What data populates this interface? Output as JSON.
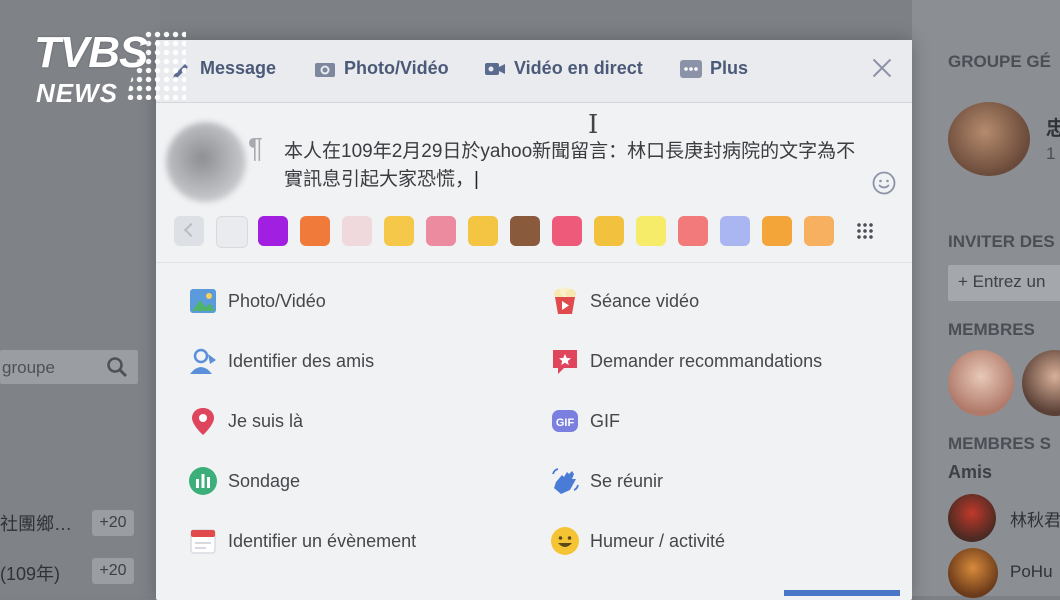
{
  "logo": {
    "brand": "TVBS",
    "sub": "NEWS"
  },
  "composer": {
    "tabs": [
      {
        "label": "Message",
        "icon": "pencil-icon"
      },
      {
        "label": "Photo/Vidéo",
        "icon": "camera-icon"
      },
      {
        "label": "Vidéo en direct",
        "icon": "video-camera-icon"
      },
      {
        "label": "Plus",
        "icon": "more-dots-icon"
      }
    ],
    "status_text": "本人在109年2月29日於yahoo新聞留言：林口長庚封病院的文字為不實訊息引起大家恐慌，",
    "emoji_swatches": [
      "#a11fe0",
      "#f07a3a",
      "#efd9dc",
      "#f5c84a",
      "#ec8aa0",
      "#f4c542",
      "#8a5a3c",
      "#ee5a7a",
      "#f2c23e",
      "#f6ec6a",
      "#f27a7a",
      "#aab6f2",
      "#f3a53a",
      "#f7b060"
    ],
    "options_left": [
      {
        "label": "Photo/Vidéo",
        "icon": "photo-icon",
        "color": "#4fb36e"
      },
      {
        "label": "Identifier des amis",
        "icon": "tag-friends-icon",
        "color": "#5b8fd9"
      },
      {
        "label": "Je suis là",
        "icon": "location-pin-icon",
        "color": "#e0455e"
      },
      {
        "label": "Sondage",
        "icon": "poll-icon",
        "color": "#3cae7a"
      },
      {
        "label": "Identifier un évènement",
        "icon": "calendar-icon",
        "color": "#e04a4a"
      }
    ],
    "options_right": [
      {
        "label": "Séance vidéo",
        "icon": "popcorn-icon",
        "color": "#e04a4a"
      },
      {
        "label": "Demander recommandations",
        "icon": "recommend-icon",
        "color": "#e0455e"
      },
      {
        "label": "GIF",
        "icon": "gif-icon",
        "color": "#7b7fe0"
      },
      {
        "label": "Se réunir",
        "icon": "wave-hand-icon",
        "color": "#4a7bd6"
      },
      {
        "label": "Humeur / activité",
        "icon": "smiley-icon",
        "color": "#f5c435"
      }
    ]
  },
  "left_panel": {
    "search_placeholder": "groupe",
    "rows": [
      {
        "label": "社團鄉…",
        "count": "+20"
      },
      {
        "label": "(109年)",
        "count": "+20"
      }
    ]
  },
  "right_panel": {
    "group_header": "GROUPE GÉ",
    "group_name": "忠",
    "group_sub": "1",
    "invite_header": "INVITER DES",
    "invite_placeholder": "Entrez un",
    "members_header": "MEMBRES",
    "members_s_header": "MEMBRES S",
    "friends_label": "Amis",
    "friend1": "林秋君",
    "friend2": "PoHu"
  }
}
